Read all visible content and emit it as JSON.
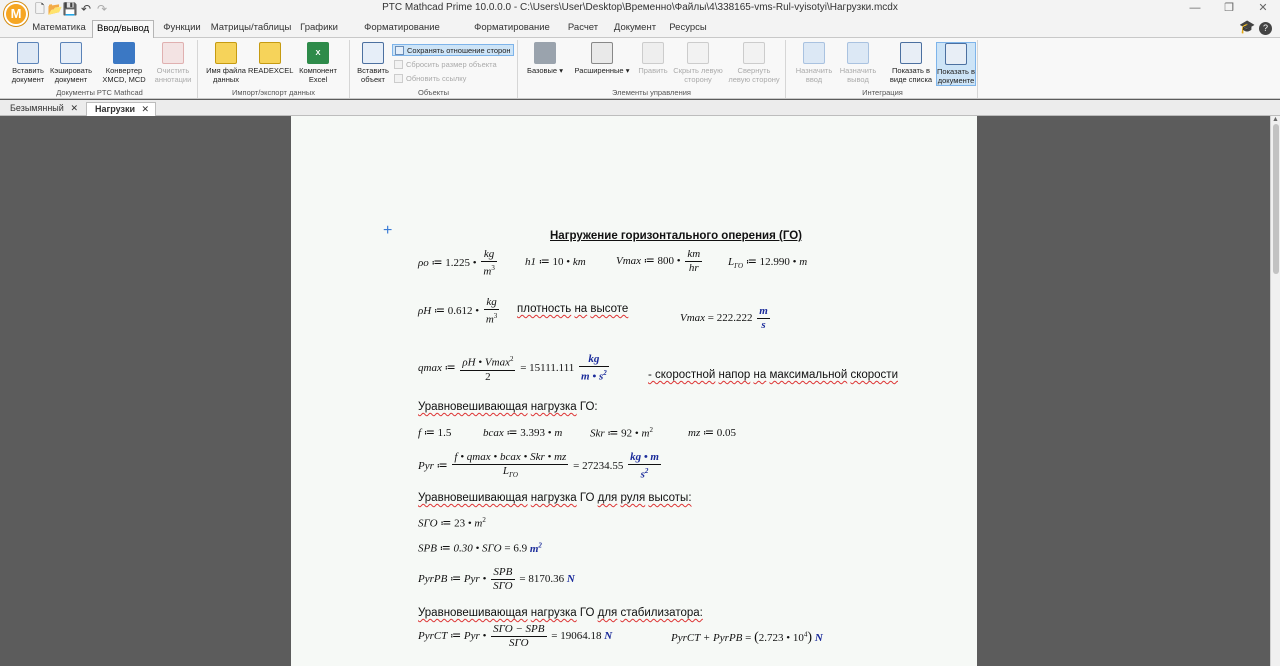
{
  "app": {
    "title": "PTC Mathcad Prime 10.0.0.0 - C:\\Users\\User\\Desktop\\Временно\\Файлы\\4\\338165-vms-Rul-vyisotyi\\Нагрузки.mcdx",
    "logo": "M"
  },
  "ribbon_tabs": [
    "Математика",
    "Ввод/вывод",
    "Функции",
    "Матрицы/таблицы",
    "Графики",
    "Форматирование формул",
    "Форматирование текста",
    "Расчет",
    "Документ",
    "Ресурсы"
  ],
  "ribbon": {
    "groups": {
      "docs": "Документы PTC Mathcad",
      "import": "Импорт/экспорт данных",
      "objects": "Объекты",
      "controls": "Элементы управления",
      "integration": "Интеграция"
    },
    "buttons": {
      "insert_doc": "Вставить документ",
      "cache_doc": "Кэшировать документ",
      "converter": "Конвертер XMCD, MCD",
      "clear_annot": "Очистить аннотации",
      "file_name": "Имя файла данных",
      "readexcel": "READEXCEL",
      "excel_comp": "Компонент Excel",
      "insert_obj": "Вставить объект",
      "keep_ratio": "Сохранять отношение сторон",
      "reset_size": "Сбросить размер объекта",
      "update_link": "Обновить ссылку",
      "basic": "Базовые",
      "advanced": "Расширенные",
      "edit": "Править",
      "hide_left": "Скрыть левую сторону",
      "collapse_left": "Свернуть левую сторону",
      "assign_input": "Назначить ввод",
      "assign_output": "Назначить вывод",
      "show_list": "Показать в виде списка",
      "show_doc": "Показать в документе"
    }
  },
  "doc_tabs": [
    "Безымянный",
    "Нагрузки"
  ],
  "worksheet": {
    "heading": "Нагружение горизонтального оперения (ГО)",
    "rho0": {
      "name": "ρo",
      "value": "1.225",
      "unit_num": "kg",
      "unit_den": "m"
    },
    "h1": {
      "name": "h1",
      "value": "10",
      "unit": "km"
    },
    "vmax": {
      "name": "Vmax",
      "value": "800",
      "unit_num": "km",
      "unit_den": "hr"
    },
    "lgo": {
      "name": "L",
      "sub": "ГО",
      "value": "12.990",
      "unit": "m"
    },
    "rhoh": {
      "name": "ρH",
      "value": "0.612",
      "unit_num": "kg",
      "unit_den": "m"
    },
    "density_note": [
      "плотность",
      "на",
      "высоте"
    ],
    "vmax_res": {
      "name": "Vmax",
      "value": "222.222",
      "unit_num": "m",
      "unit_den": "s"
    },
    "qmax": {
      "name": "qmax",
      "num": "ρH • Vmax",
      "den": "2",
      "value": "15111.111",
      "unit_num": "kg",
      "unit_den": "m • s"
    },
    "qmax_note": [
      "- скоростной",
      "напор",
      "на",
      "максимальной",
      "скорости"
    ],
    "balancing_title": [
      "Уравновешивающая",
      "нагрузка",
      "ГО:"
    ],
    "f": {
      "name": "f",
      "value": "1.5"
    },
    "bcax": {
      "name": "bcax",
      "value": "3.393",
      "unit": "m"
    },
    "skr": {
      "name": "Skr",
      "value": "92",
      "unit": "m"
    },
    "mz": {
      "name": "mz",
      "value": "0.05"
    },
    "pyr": {
      "name": "Pyr",
      "num": "f • qmax • bcax • Skr • mz",
      "den_name": "L",
      "den_sub": "ГО",
      "value": "27234.55",
      "unit_num": "kg • m",
      "unit_den": "s"
    },
    "rudder_title": [
      "Уравновешивающая",
      "нагрузка",
      "ГО",
      "для",
      "руля",
      "высоты:"
    ],
    "sgo": {
      "name": "SГО",
      "value": "23",
      "unit": "m"
    },
    "spb": {
      "name": "SPB",
      "expr": "0.30 • SГО",
      "value": "6.9",
      "unit": "m"
    },
    "pyrpb": {
      "name": "PyrPB",
      "pre": "Pyr •",
      "num": "SPB",
      "den": "SГО",
      "value": "8170.36",
      "unit": "N"
    },
    "stab_title": [
      "Уравновешивающая",
      "нагрузка",
      "ГО",
      "для",
      "стабилизатора:"
    ],
    "pyrct": {
      "name": "PyrCT",
      "pre": "Pyr •",
      "num": "SГО − SPB",
      "den": "SГО",
      "value": "19064.18",
      "unit": "N"
    },
    "sum": {
      "expr": "PyrCT + PyrPB",
      "value": "2.723 • 10",
      "exp": "4",
      "unit": "N"
    }
  }
}
